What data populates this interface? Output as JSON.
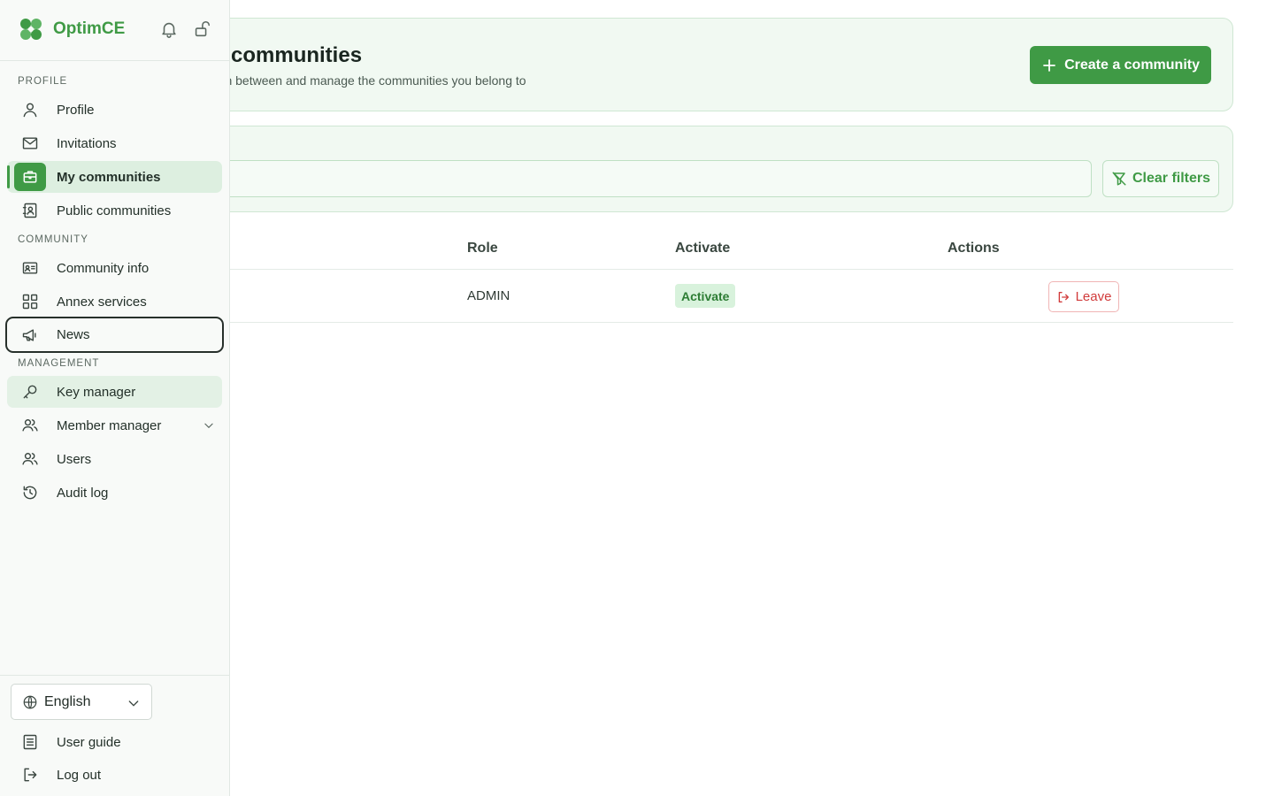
{
  "app": {
    "name": "OptimCE"
  },
  "header": {
    "title": "My communities",
    "subtitle": "Switch between and manage the communities you belong to",
    "create_label": "Create a community"
  },
  "filters": {
    "search_value": "",
    "clear_label": "Clear filters"
  },
  "table": {
    "columns": {
      "role": "Role",
      "activate": "Activate",
      "actions": "Actions"
    },
    "rows": [
      {
        "role": "ADMIN",
        "activate_label": "Activate",
        "leave_label": "Leave"
      }
    ]
  },
  "sidebar": {
    "sections": {
      "profile": "PROFILE",
      "community": "COMMUNITY",
      "management": "MANAGEMENT"
    },
    "items": {
      "profile": "Profile",
      "invitations": "Invitations",
      "my_communities": "My communities",
      "public_communities": "Public communities",
      "community_info": "Community info",
      "annex_services": "Annex services",
      "news": "News",
      "key_manager": "Key manager",
      "member_manager": "Member manager",
      "users": "Users",
      "audit_log": "Audit log"
    },
    "language": "English",
    "user_guide": "User guide",
    "logout": "Log out"
  },
  "colors": {
    "accent": "#3f9a45",
    "danger": "#d13b3b",
    "panel": "#f1f9f2"
  },
  "icons": [
    "clover-logo-icon",
    "bell-icon",
    "unlock-icon",
    "user-icon",
    "mail-icon",
    "briefcase-icon",
    "contact-book-icon",
    "id-card-icon",
    "grid-icon",
    "megaphone-icon",
    "key-icon",
    "users-icon",
    "history-icon",
    "globe-icon",
    "book-icon",
    "logout-icon",
    "plus-icon",
    "filter-clear-icon",
    "leave-icon",
    "chevron-down-icon"
  ]
}
